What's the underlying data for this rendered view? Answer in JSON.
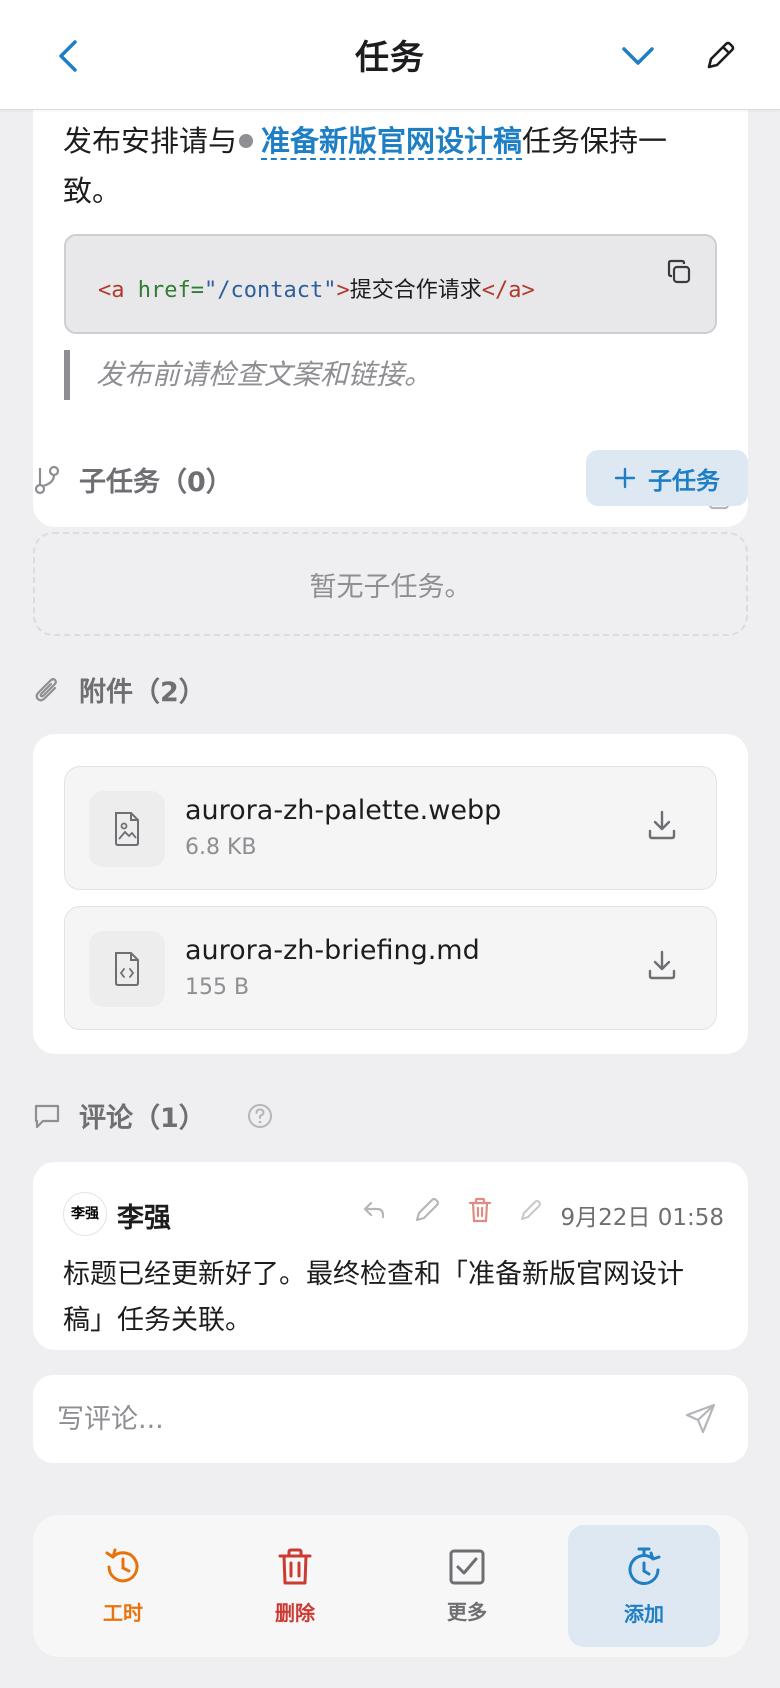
{
  "header": {
    "title": "任务",
    "back_icon": "chevron-left-icon",
    "expand_icon": "chevron-down-icon",
    "edit_icon": "pencil-icon"
  },
  "description": {
    "text_before": "发布安排请与",
    "link_text": "准备新版官网设计稿",
    "text_after": "任务保持一致。",
    "code": {
      "tag_open_start": "<a",
      "attr": " href=",
      "value": "\"/contact\"",
      "tag_open_end": ">",
      "inner": "提交合作请求",
      "tag_close": "</a>"
    },
    "quote": "发布前请检查文案和链接。"
  },
  "subtasks": {
    "title": "子任务（0）",
    "add_label": "子任务",
    "empty_text": "暂无子任务。"
  },
  "attachments": {
    "title": "附件（2）",
    "files": [
      {
        "name": "aurora-zh-palette.webp",
        "size": "6.8 KB",
        "icon": "image-file-icon"
      },
      {
        "name": "aurora-zh-briefing.md",
        "size": "155 B",
        "icon": "code-file-icon"
      }
    ]
  },
  "comments": {
    "title": "评论（1）",
    "items": [
      {
        "author": "李强",
        "avatar_text": "李强",
        "time": "9月22日 01:58",
        "body": "标题已经更新好了。最终检查和「准备新版官网设计稿」任务关联。"
      }
    ],
    "input_placeholder": "写评论..."
  },
  "bottom_tabs": [
    {
      "label": "工时",
      "icon": "history-clock-icon",
      "color": "#e8730c"
    },
    {
      "label": "删除",
      "icon": "trash-icon",
      "color": "#cc3b33"
    },
    {
      "label": "更多",
      "icon": "checkbox-icon",
      "color": "#6e6e73"
    },
    {
      "label": "添加",
      "icon": "timer-add-icon",
      "color": "#1f7fc4"
    }
  ],
  "colors": {
    "accent": "#1f7fc4",
    "danger": "#cc3b33",
    "warning": "#e8730c",
    "muted": "#8e8e93"
  }
}
